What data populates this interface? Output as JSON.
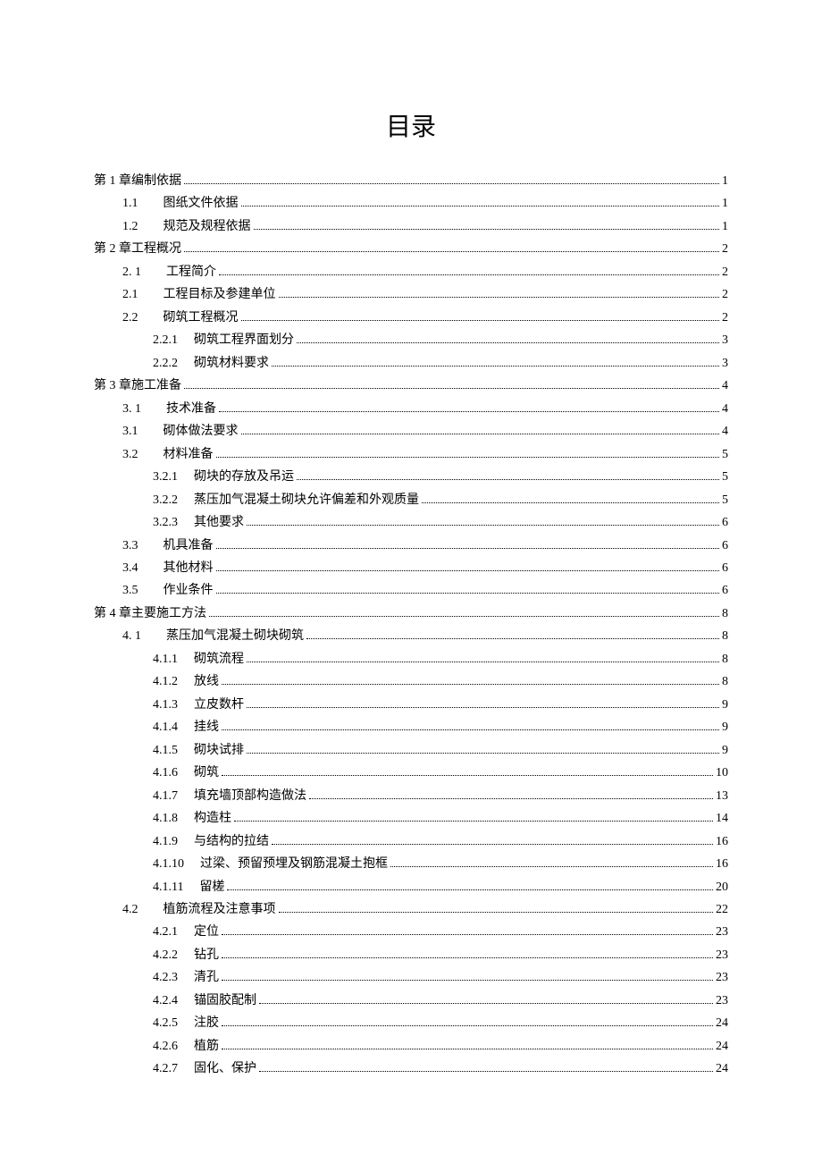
{
  "title": "目录",
  "entries": [
    {
      "level": 0,
      "num": "第 1 章",
      "gap": "none",
      "text": "编制依据",
      "page": "1"
    },
    {
      "level": 1,
      "num": "1.1",
      "gap": "wide",
      "text": "图纸文件依据",
      "page": "1"
    },
    {
      "level": 1,
      "num": "1.2",
      "gap": "wide",
      "text": "规范及规程依据",
      "page": "1"
    },
    {
      "level": 0,
      "num": "第 2 章",
      "gap": "none",
      "text": "工程概况",
      "page": "2"
    },
    {
      "level": 1,
      "num": "2.  1",
      "gap": "wide",
      "text": "工程简介",
      "page": "2"
    },
    {
      "level": 1,
      "num": "2.1",
      "gap": "wide",
      "text": "工程目标及参建单位",
      "page": "2"
    },
    {
      "level": 1,
      "num": "2.2",
      "gap": "wide",
      "text": "砌筑工程概况",
      "page": "2"
    },
    {
      "level": 2,
      "num": "2.2.1",
      "gap": "mid",
      "text": "砌筑工程界面划分",
      "page": "3"
    },
    {
      "level": 2,
      "num": "2.2.2",
      "gap": "mid",
      "text": "砌筑材料要求",
      "page": "3"
    },
    {
      "level": 0,
      "num": "第 3 章",
      "gap": "none",
      "text": "施工准备",
      "page": "4"
    },
    {
      "level": 1,
      "num": "3.  1",
      "gap": "wide",
      "text": "技术准备",
      "page": "4"
    },
    {
      "level": 1,
      "num": "3.1",
      "gap": "wide",
      "text": "砌体做法要求",
      "page": "4"
    },
    {
      "level": 1,
      "num": "3.2",
      "gap": "wide",
      "text": "材料准备",
      "page": "5"
    },
    {
      "level": 2,
      "num": "3.2.1",
      "gap": "mid",
      "text": "砌块的存放及吊运",
      "page": "5"
    },
    {
      "level": 2,
      "num": "3.2.2",
      "gap": "mid",
      "text": "蒸压加气混凝土砌块允许偏差和外观质量",
      "page": "5"
    },
    {
      "level": 2,
      "num": "3.2.3",
      "gap": "mid",
      "text": "其他要求",
      "page": "6"
    },
    {
      "level": 1,
      "num": "3.3",
      "gap": "wide",
      "text": "机具准备",
      "page": "6"
    },
    {
      "level": 1,
      "num": "3.4",
      "gap": "wide",
      "text": "其他材料",
      "page": "6"
    },
    {
      "level": 1,
      "num": "3.5",
      "gap": "wide",
      "text": "作业条件",
      "page": "6"
    },
    {
      "level": 0,
      "num": "第 4 章",
      "gap": "none",
      "text": "主要施工方法",
      "page": "8"
    },
    {
      "level": 1,
      "num": "4.  1",
      "gap": "wide",
      "text": "蒸压加气混凝土砌块砌筑",
      "page": "8"
    },
    {
      "level": 2,
      "num": "4.1.1",
      "gap": "mid",
      "text": "砌筑流程",
      "page": "8"
    },
    {
      "level": 2,
      "num": "4.1.2",
      "gap": "mid",
      "text": "放线",
      "page": "8"
    },
    {
      "level": 2,
      "num": "4.1.3",
      "gap": "mid",
      "text": "立皮数杆",
      "page": "9"
    },
    {
      "level": 2,
      "num": "4.1.4",
      "gap": "mid",
      "text": "挂线",
      "page": "9"
    },
    {
      "level": 2,
      "num": "4.1.5",
      "gap": "mid",
      "text": "砌块试排",
      "page": "9"
    },
    {
      "level": 2,
      "num": "4.1.6",
      "gap": "mid",
      "text": "砌筑",
      "page": "10"
    },
    {
      "level": 2,
      "num": "4.1.7",
      "gap": "mid",
      "text": "填充墙顶部构造做法",
      "page": "13"
    },
    {
      "level": 2,
      "num": "4.1.8",
      "gap": "mid",
      "text": "构造柱",
      "page": "14"
    },
    {
      "level": 2,
      "num": "4.1.9",
      "gap": "mid",
      "text": "与结构的拉结",
      "page": "16"
    },
    {
      "level": 2,
      "num": "4.1.10",
      "gap": "mid",
      "text": "过梁、预留预埋及钢筋混凝土抱框",
      "page": "16"
    },
    {
      "level": 2,
      "num": "4.1.11",
      "gap": "mid",
      "text": "留槎",
      "page": "20"
    },
    {
      "level": 1,
      "num": "4.2",
      "gap": "wide",
      "text": "植筋流程及注意事项",
      "page": "22"
    },
    {
      "level": 2,
      "num": "4.2.1",
      "gap": "mid",
      "text": "定位",
      "page": "23"
    },
    {
      "level": 2,
      "num": "4.2.2",
      "gap": "mid",
      "text": "钻孔",
      "page": "23"
    },
    {
      "level": 2,
      "num": "4.2.3",
      "gap": "mid",
      "text": "清孔",
      "page": "23"
    },
    {
      "level": 2,
      "num": "4.2.4",
      "gap": "mid",
      "text": "锚固胶配制",
      "page": "23"
    },
    {
      "level": 2,
      "num": "4.2.5",
      "gap": "mid",
      "text": "注胶",
      "page": "24"
    },
    {
      "level": 2,
      "num": "4.2.6",
      "gap": "mid",
      "text": "植筋",
      "page": "24"
    },
    {
      "level": 2,
      "num": "4.2.7",
      "gap": "mid",
      "text": "固化、保护",
      "page": "24"
    }
  ]
}
